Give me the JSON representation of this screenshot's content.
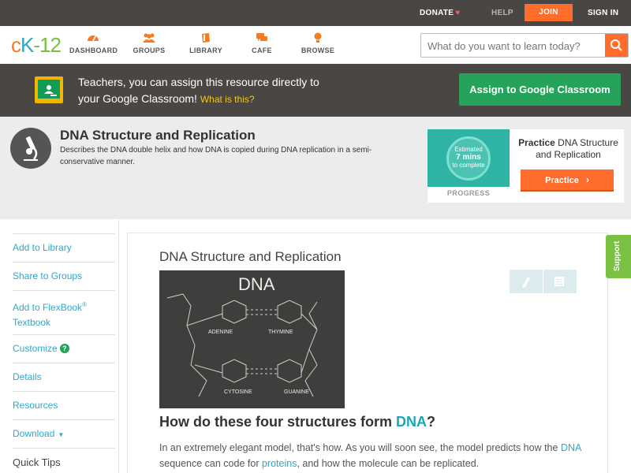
{
  "topbar": {
    "donate": "DONATE",
    "help": "HELP",
    "join": "JOIN",
    "signin": "SIGN IN"
  },
  "logo": {
    "c": "c",
    "k": "K",
    "n": "-12"
  },
  "nav": {
    "items": [
      {
        "label": "DASHBOARD",
        "icon": "dashboard-icon"
      },
      {
        "label": "GROUPS",
        "icon": "groups-icon"
      },
      {
        "label": "LIBRARY",
        "icon": "library-icon"
      },
      {
        "label": "CAFE",
        "icon": "cafe-icon"
      },
      {
        "label": "BROWSE",
        "icon": "browse-icon"
      }
    ],
    "search_placeholder": "What do you want to learn today?"
  },
  "banner": {
    "text_line1": "Teachers, you can assign this resource directly to",
    "text_line2": "your Google Classroom!",
    "what_link": "What is this?",
    "assign_button": "Assign to Google Classroom"
  },
  "concept": {
    "title": "DNA Structure and Replication",
    "description": "Describes the DNA double helix and how DNA is copied during DNA replication in a semi-conservative manner."
  },
  "practice": {
    "estimated": "Estimated",
    "mins": "7 mins",
    "to_complete": "to complete",
    "progress_label": "PROGRESS",
    "head_bold": "Practice",
    "head_rest": "DNA Structure and Replication",
    "button": "Practice"
  },
  "sidebar": {
    "add_to_library": "Add to Library",
    "share_to_groups": "Share to Groups",
    "add_to_flexbook": "Add to FlexBook",
    "reg": "®",
    "textbook": "Textbook",
    "customize": "Customize",
    "details": "Details",
    "resources": "Resources",
    "download": "Download",
    "quick_tips": "Quick Tips"
  },
  "content": {
    "title": "DNA Structure and Replication",
    "image_labels": {
      "dna": "DNA",
      "adenine": "ADENINE",
      "thymine": "THYMINE",
      "cytosine": "CYTOSINE",
      "guanine": "GUANINE"
    },
    "question_pre": "How do these four structures form",
    "question_kw": "DNA",
    "question_post": "?",
    "para_1": "In an extremely elegant model, that's how. As you will soon see, the model predicts how the",
    "para_kw1": "DNA",
    "para_2": "sequence can code for",
    "para_kw2": "proteins",
    "para_3": ", and how the molecule can be replicated."
  },
  "support": "Support",
  "colors": {
    "accent_orange": "#ff6c2c",
    "dark_bar": "#4a4643",
    "link_blue": "#2ea7c9",
    "green": "#25a35a",
    "teal": "#2fb3a4"
  }
}
